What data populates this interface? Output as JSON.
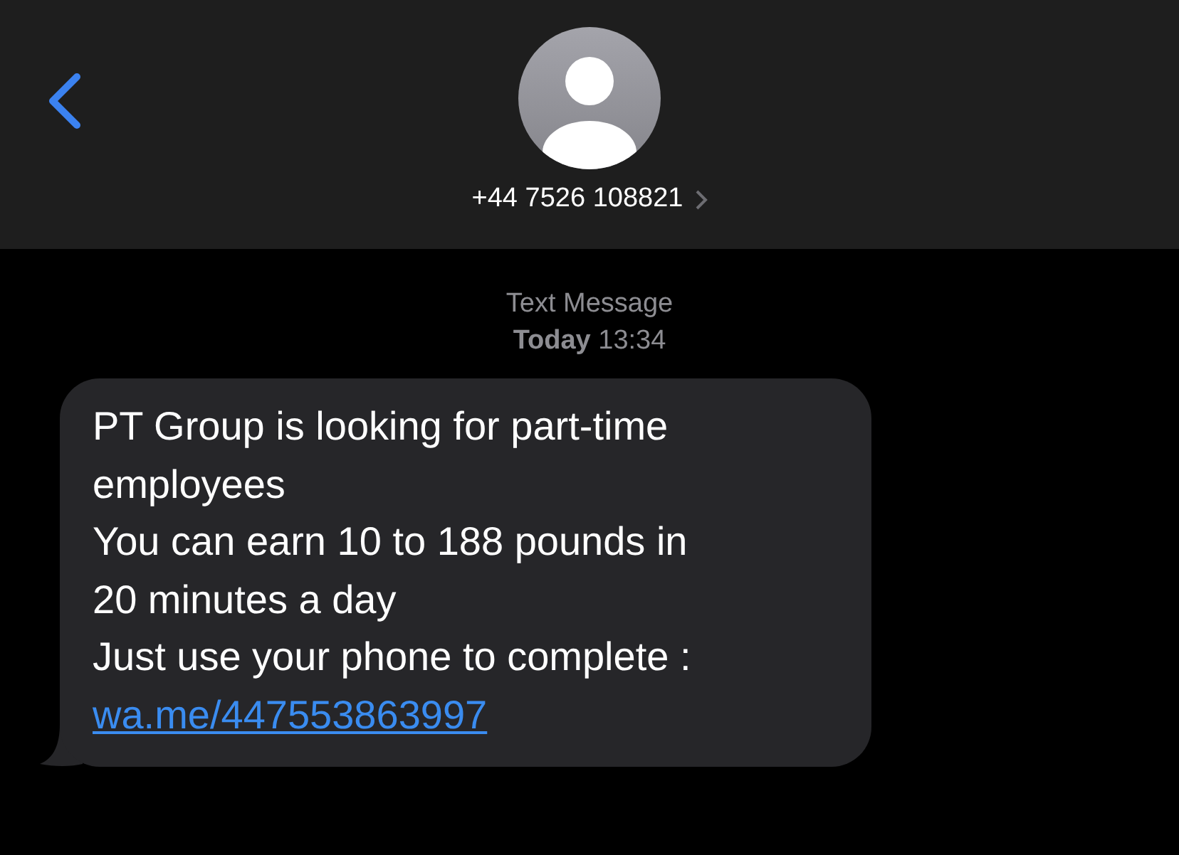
{
  "header": {
    "contact": "+44 7526 108821"
  },
  "thread": {
    "service": "Text Message",
    "timestamp": "**Today** 13:34"
  },
  "messages": [
    {
      "lines": [
        "PT Group is looking for part-time employees",
        "You can earn 10 to 188 pounds in 20 minutes a day",
        "Just use your phone to complete :"
      ],
      "link": "wa.me/447553863997"
    }
  ]
}
